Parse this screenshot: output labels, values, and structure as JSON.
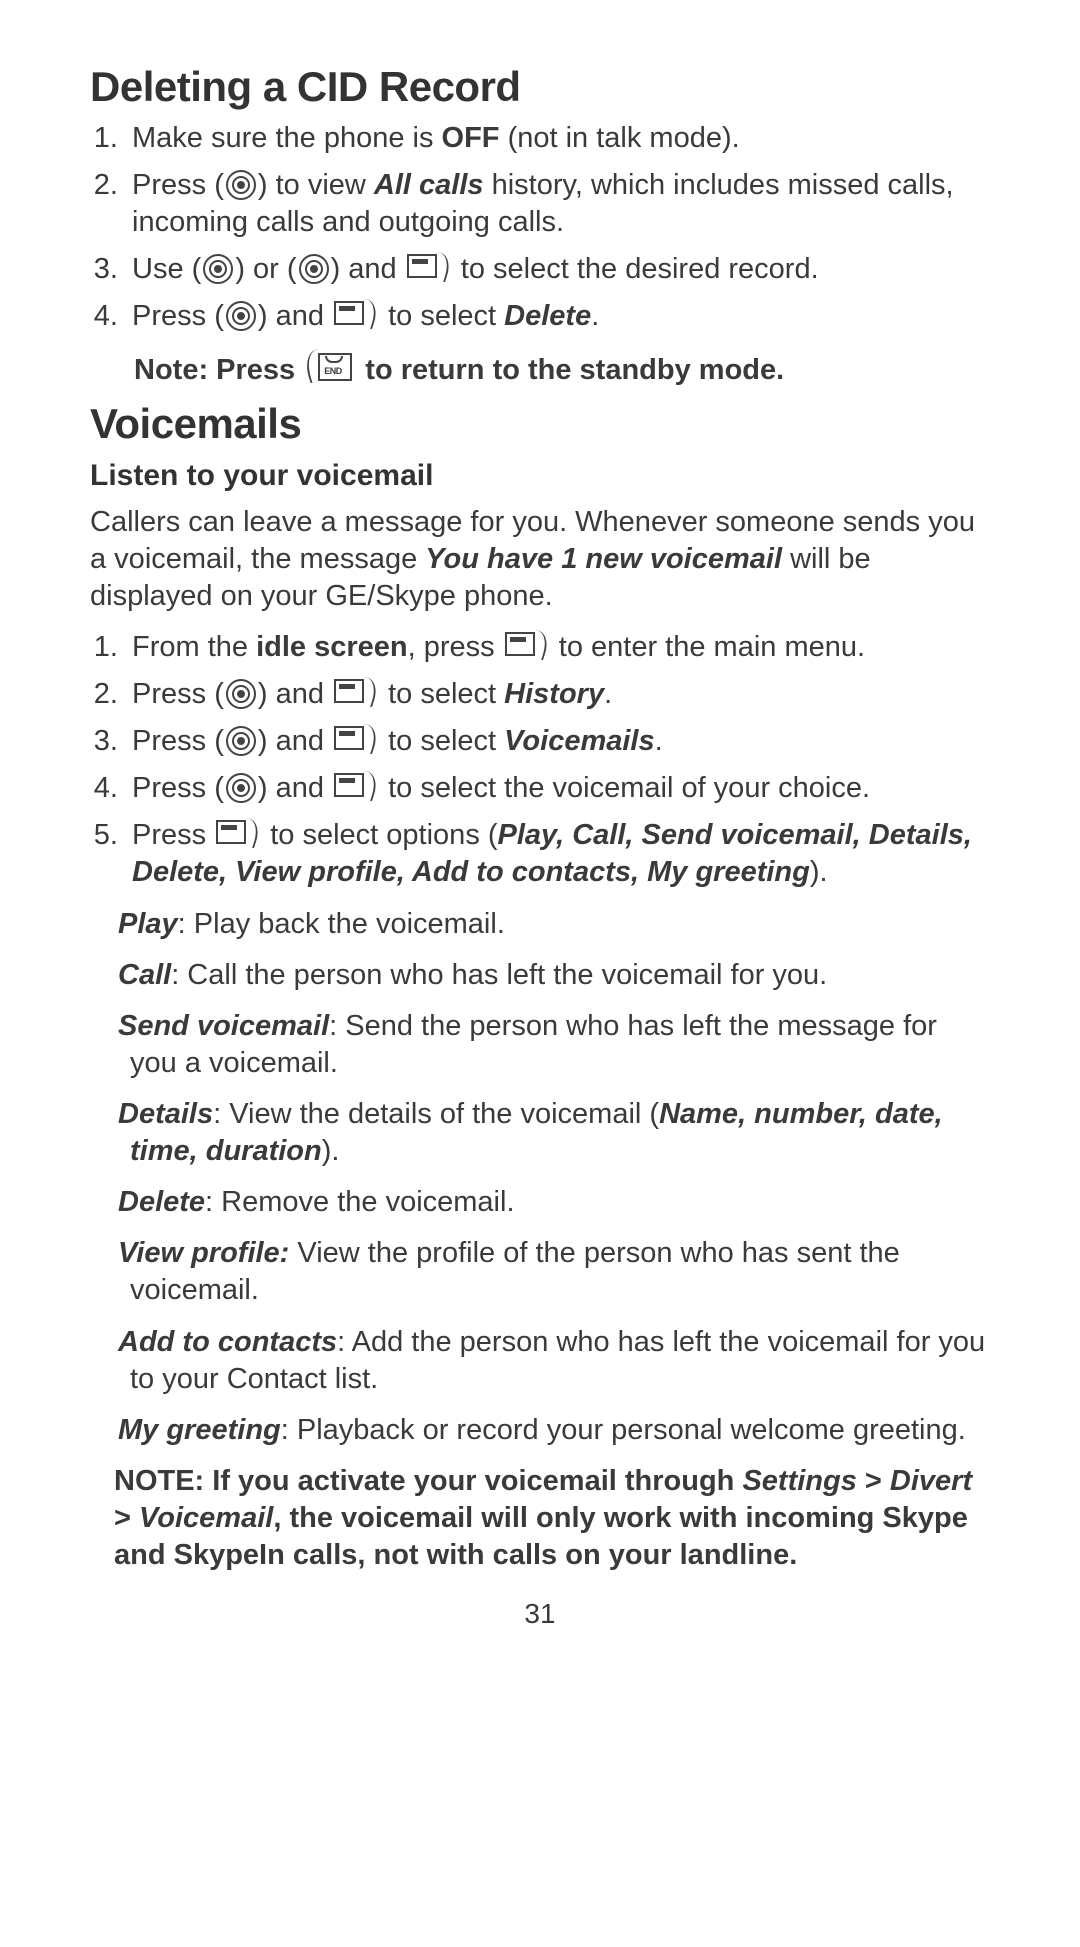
{
  "section1": {
    "heading": "Deleting a CID Record",
    "steps": {
      "s1_a": "Make sure the phone is ",
      "s1_b": "OFF",
      "s1_c": " (not in talk mode).",
      "s2_a": "Press ",
      "s2_b": " to view ",
      "s2_c": "All calls",
      "s2_d": " history, which includes missed calls, incoming calls and outgoing calls.",
      "s3_a": "Use ",
      "s3_b": " or ",
      "s3_c": " and  ",
      "s3_d": " to select the desired record.",
      "s4_a": "Press ",
      "s4_b": " and ",
      "s4_c": " to select ",
      "s4_d": "Delete",
      "s4_e": "."
    },
    "note_a": "Note: Press  ",
    "note_b": " to return to the standby mode."
  },
  "section2": {
    "heading": "Voicemails",
    "sub": "Listen to your voicemail",
    "intro_a": "Callers can leave a message for you. Whenever someone sends you a voicemail, the message ",
    "intro_b": "You have 1 new voicemail",
    "intro_c": " will be displayed on your GE/Skype phone.",
    "steps": {
      "s1_a": "From the ",
      "s1_b": "idle screen",
      "s1_c": ", press  ",
      "s1_d": " to enter the main menu.",
      "s2_a": "Press ",
      "s2_b": " and ",
      "s2_c": " to select ",
      "s2_d": "History",
      "s2_e": ".",
      "s3_a": "Press ",
      "s3_b": " and ",
      "s3_c": " to select ",
      "s3_d": "Voicemails",
      "s3_e": ".",
      "s4_a": "Press ",
      "s4_b": " and ",
      "s4_c": " to select the voicemail of your choice.",
      "s5_a": "Press ",
      "s5_b": "  to select options (",
      "s5_c": "Play, Call, Send voicemail, Details, Delete, View profile, Add to contacts, My greeting",
      "s5_d": ")."
    },
    "options": {
      "play_t": "Play",
      "play_d": ": Play back the voicemail.",
      "call_t": "Call",
      "call_d": ": Call the person who has left the voicemail for you.",
      "sv_t": "Send voicemail",
      "sv_d": ": Send the person who has left the message for you a voicemail.",
      "det_t": "Details",
      "det_d1": ": View the details of the voicemail (",
      "det_d2": "Name, number, date, time, duration",
      "det_d3": ").",
      "del_t": "Delete",
      "del_d": ":  Remove the voicemail.",
      "vp_t": "View profile:",
      "vp_d": " View the profile of the person who has sent the voicemail.",
      "atc_t": "Add to contacts",
      "atc_d": ": Add the person who has left the voicemail for you to your Contact list.",
      "mg_t": "My greeting",
      "mg_d": ": Playback or record your personal welcome greeting."
    },
    "note_a": "NOTE:  If you activate your voicemail through ",
    "note_b": "Settings",
    "note_c": " > ",
    "note_d": "Divert",
    "note_e": " > ",
    "note_f": "Voicemail",
    "note_g": ", the voicemail will only work with incoming Skype and SkypeIn calls, not with calls on your landline."
  },
  "page_number": "31",
  "icons": {
    "end_label": "END"
  }
}
